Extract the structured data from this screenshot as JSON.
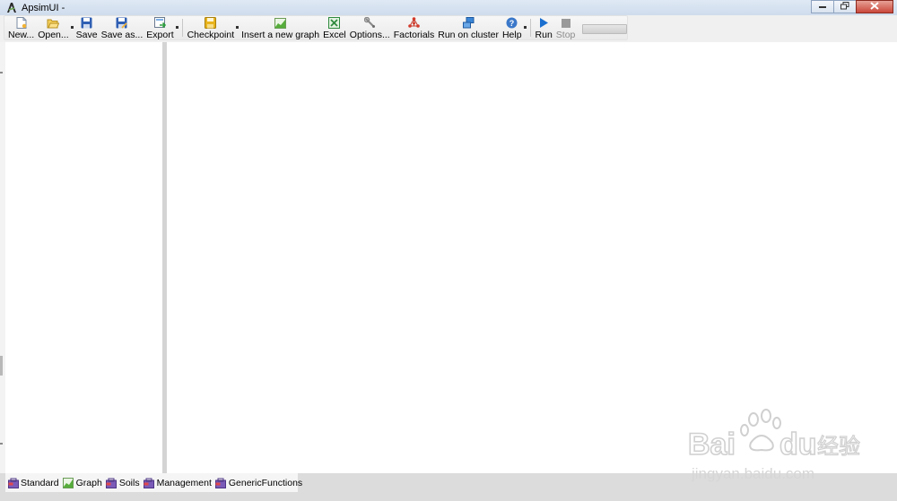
{
  "window": {
    "title": "ApsimUI -",
    "controls": [
      "minimize",
      "restore",
      "close"
    ]
  },
  "toolbar": {
    "items": [
      {
        "label": "New...",
        "icon": "new-file-icon",
        "dropdown": false
      },
      {
        "label": "Open...",
        "icon": "open-folder-icon",
        "dropdown": true
      },
      {
        "label": "Save",
        "icon": "save-icon",
        "dropdown": false
      },
      {
        "label": "Save as...",
        "icon": "save-as-icon",
        "dropdown": false
      },
      {
        "label": "Export",
        "icon": "export-icon",
        "dropdown": true
      },
      {
        "label": "Checkpoint",
        "icon": "checkpoint-icon",
        "dropdown": true
      },
      {
        "label": "Insert a new graph",
        "icon": "graph-icon",
        "dropdown": false
      },
      {
        "label": "Excel",
        "icon": "excel-icon",
        "dropdown": false
      },
      {
        "label": "Options...",
        "icon": "wrench-icon",
        "dropdown": false
      },
      {
        "label": "Factorials",
        "icon": "factorials-icon",
        "dropdown": false
      },
      {
        "label": "Run on cluster",
        "icon": "cluster-icon",
        "dropdown": false
      },
      {
        "label": "Help",
        "icon": "help-icon",
        "dropdown": true
      },
      {
        "label": "Run",
        "icon": "play-icon",
        "dropdown": false
      },
      {
        "label": "Stop",
        "icon": "stop-icon",
        "dropdown": false,
        "disabled": true
      }
    ],
    "progress": 0
  },
  "bottom_tabs": [
    {
      "label": "Standard",
      "icon": "toolbox-icon"
    },
    {
      "label": "Graph",
      "icon": "graph-icon"
    },
    {
      "label": "Soils",
      "icon": "toolbox-icon"
    },
    {
      "label": "Management",
      "icon": "toolbox-icon"
    },
    {
      "label": "GenericFunctions",
      "icon": "toolbox-icon"
    }
  ],
  "watermark": {
    "brand": "Bai du 经验",
    "url": "jingyan.baidu.com"
  },
  "colors": {
    "titlebar": "#cfdcec",
    "toolbar": "#f0f0f0",
    "panel": "#ffffff",
    "splitter": "#d4d4d4",
    "close_button": "#c9473a",
    "run_icon": "#1b6fcf"
  }
}
